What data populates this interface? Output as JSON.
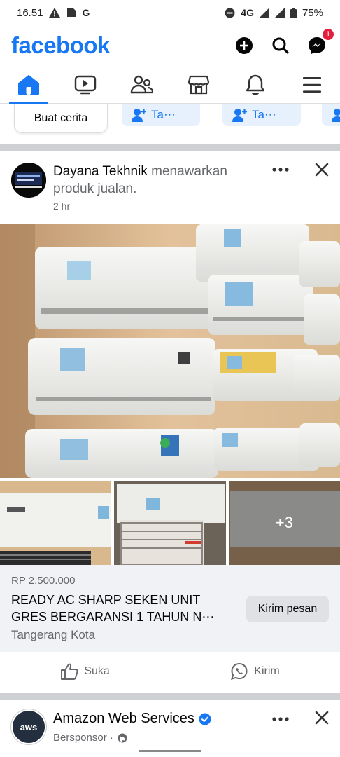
{
  "status_bar": {
    "time": "16.51",
    "left_icons": [
      "warning-icon",
      "sim-icon",
      "g-letter-icon"
    ],
    "network": "4G",
    "battery": "75%"
  },
  "header": {
    "logo": "facebook",
    "messenger_badge": "1"
  },
  "nav_tabs": [
    "home",
    "watch",
    "friends",
    "marketplace",
    "notifications",
    "menu"
  ],
  "stories": {
    "create_label": "Buat cerita",
    "chip_1": "Ta⋯",
    "chip_2": "Ta⋯"
  },
  "post": {
    "author": "Dayana Tekhnik",
    "verb": "menawarkan produk jualan.",
    "time": "2 hr",
    "more_photos": "+3",
    "price": "RP 2.500.000",
    "title": "READY AC SHARP SEKEN UNIT GRES BERGARANSI 1 TAHUN N⋯",
    "location": "Tangerang Kota",
    "send_button": "Kirim pesan",
    "like_label": "Suka",
    "share_label": "Kirim"
  },
  "post2": {
    "author": "Amazon Web Services",
    "avatar_text": "aws",
    "sponsored": "Bersponsor ·"
  },
  "colors": {
    "brand": "#1877f2",
    "badge": "#e41e3f"
  }
}
